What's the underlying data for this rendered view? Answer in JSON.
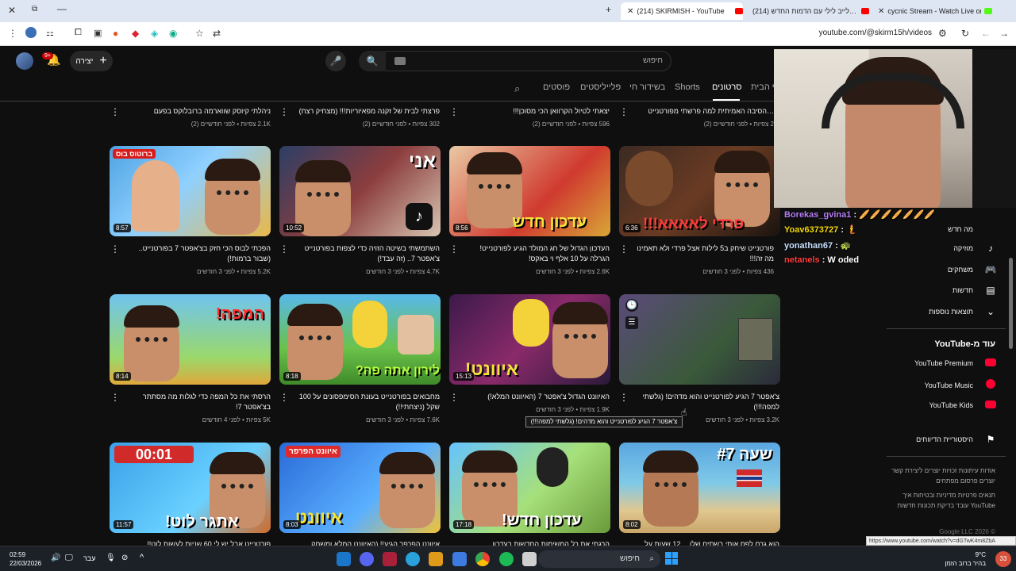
{
  "browser": {
    "tabs": [
      {
        "title": "(214) SKIRMISH - YouTube",
        "active": true
      },
      {
        "title": "(214) לייב לילי עם הדמות החדש…",
        "active": false
      },
      {
        "title": "cycnic Stream - Watch Live on…",
        "active": false
      }
    ],
    "url": "youtube.com/@skirm15h/videos"
  },
  "header": {
    "create_label": "יצירה",
    "notif_count": "9+",
    "search_placeholder": "חיפוש"
  },
  "channel_tabs": [
    "פוסטים",
    "פלייליסטים",
    "בשידור חי",
    "Shorts",
    "סרטונים",
    "דף הבית"
  ],
  "top_row": [
    {
      "title": "ניהלתי קיוסק שווארמה ברובלוקס בפעם הראשונה!",
      "meta": "2.1K צפיות • לפני חודשיים (2)"
    },
    {
      "title": "פרצתי לבית של זקנה מפאיוריות!!! (מצחיק רצח)",
      "meta": "302 צפיות • לפני חודשיים (2)"
    },
    {
      "title": "יצאתי לטיול הקרוואן הכי מסוכן!!!",
      "meta": "596 צפיות • לפני חודשיים (2)"
    },
    {
      "title": "…הסיבה האמיתית למה פרשתי מפורטנייט",
      "meta": "2 צפיות • לפני חודשיים (2)"
    }
  ],
  "row2": [
    {
      "title": "הפכתי לבוס הכי חזק בצ'אפטר 7 בפורטנייט..(שבור ברמות!)",
      "meta": "5.2K צפיות • לפני 3 חודשים",
      "duration": "8:57",
      "overlay": "ברוטוס בוס"
    },
    {
      "title": "השתמשתי בשיטה הזויה כדי לצפות בפורטנייט צ'אפטר 7.. (זה עבד!)",
      "meta": "4.7K צפיות • לפני 3 חודשים",
      "duration": "10:52",
      "overlay": "אני"
    },
    {
      "title": "העדכון הגדול של חג המולד הגיע לפורטנייט! הגרלה על 10 אלף וי באקס!",
      "meta": "2.6K צפיות • לפני 3 חודשים",
      "duration": "8:56",
      "overlay": "עדכון חדש"
    },
    {
      "title": "פורטנייט שיחק ב5 לילות אצל פרדי ולא תאמינו מה זה!!!",
      "meta": "436 צפיות • לפני 3 חודשים",
      "duration": "6:36",
      "overlay": "פרדי לאאאא!!!"
    }
  ],
  "row3": [
    {
      "title": "הרסתי את כל המפה כדי לגלות מה מסתתר בצ'אפטר 7!",
      "meta": "5K צפיות • לפני 4 חודשים",
      "duration": "8:14",
      "overlay": "המפה!"
    },
    {
      "title": "מחבואים בפורטנייט בעונת הסימפסונים על 100 שקל (ניצחתי!!)",
      "meta": "7.6K צפיות • לפני 3 חודשים",
      "duration": "8:18",
      "overlay": "לירון אתה פה?"
    },
    {
      "title": "האיוונט הגדול צ'אפטר 7 (האיוונט המלא!)",
      "meta": "1.9K צפיות • לפני 3 חודשים",
      "duration": "15:13",
      "overlay": "איוונט!"
    },
    {
      "title": "צ'אפטר 7 הגיע לפורטנייט והוא מדהים! (גלשתי למפה!!!)",
      "meta": "3.2K צפיות • לפני 3 חודשים",
      "duration": "",
      "overlay": ""
    }
  ],
  "row4": [
    {
      "title": "פורטנייט אבל יש לי 60 שניות לעשות לוט!! (בלתי…",
      "duration": "11:57",
      "overlay": "אתגר לוט!",
      "overlay2": "00:01"
    },
    {
      "title": "איוונט הפרפר הגיע!! (האיוונט המלא ומשחק ראשון",
      "duration": "8:03",
      "overlay": "איוונט",
      "overlay2": "איוונט הפרפר"
    },
    {
      "title": "הרגתי את כל המשימות החדשות בעדכון החדש…",
      "duration": "17:18",
      "overlay": "עדכון חדש!"
    },
    {
      "title": "הוא גרם לפס אותי בשתים שלו… 12 שעות על היבש",
      "duration": "8:02",
      "overlay": "שעה #7"
    }
  ],
  "tooltip": "צ'אפטר 7 הגיע לפורטנייט והוא מדהים! (גלשתי למפה!!!)",
  "chat": [
    {
      "user": "Borekas_gvina1",
      "msg": "🥖🥖🥖🥖🥖🥖🥖",
      "color": "#b77df7"
    },
    {
      "user": "Yoav6373727",
      "msg": "🧜",
      "color": "#f5d90a"
    },
    {
      "user": "yonathan67",
      "msg": "🐢",
      "color": "#c7e0ff"
    },
    {
      "user": "netanels",
      "msg": "W oded",
      "color": "#ff3c3c"
    }
  ],
  "sidebar": {
    "items": [
      {
        "label": "מה חדש",
        "icon": ""
      },
      {
        "label": "מוזיקה",
        "icon": "♪"
      },
      {
        "label": "משחקים",
        "icon": "🎮"
      },
      {
        "label": "חדשות",
        "icon": "▤"
      },
      {
        "label": "תוצאות נוספות",
        "icon": "⌄"
      }
    ],
    "more_title": "עוד מ-YouTube",
    "more": [
      "YouTube Premium",
      "YouTube Music",
      "YouTube Kids"
    ],
    "report_history": "היסטוריית הדיווחים",
    "footer1": "אודות עיתונות זכויות יוצרים ליצירת קשר יוצרים פרסום מפתחים",
    "footer2": "תנאים פרטיות מדיניות ובטיחות איך YouTube עובד בדיקת תכונות חדשות",
    "copyright": "© 2026 Google LLC"
  },
  "status_url": "https://www.youtube.com/watch?v=dGTwK4m8ZbA",
  "taskbar": {
    "time": "02:59",
    "date": "22/03/2026",
    "lang": "עבר",
    "search": "חיפוש",
    "temp": "9°C",
    "weather": "בהיר ברוב הזמן",
    "notif": "33"
  }
}
